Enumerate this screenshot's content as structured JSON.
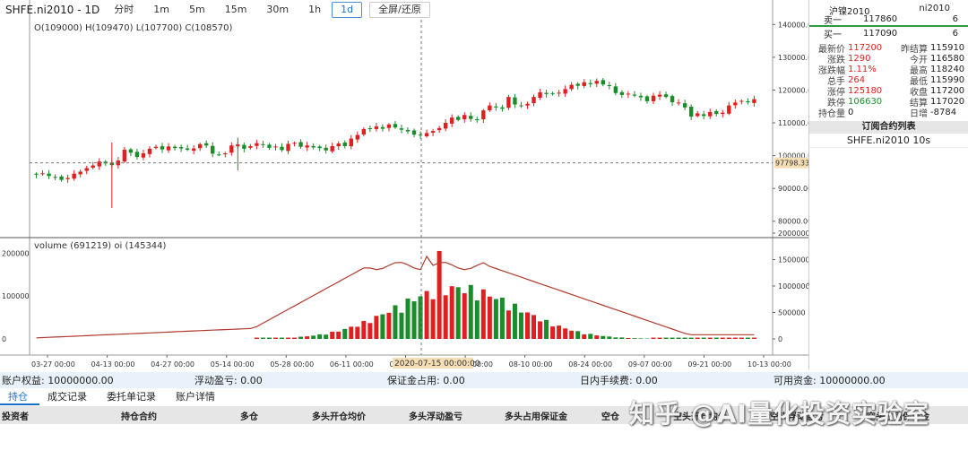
{
  "toolbar": {
    "symbol": "SHFE.ni2010 - 1D",
    "intervals": [
      "分时",
      "1m",
      "5m",
      "15m",
      "30m",
      "1h",
      "1d"
    ],
    "active_interval": "1d",
    "fullscreen_label": "全屏/还原"
  },
  "ohlc_label": "O(109000) H(109470) L(107700) C(108570)",
  "volume_label": "volume (691219) oi (145344)",
  "crosshair_price": "97798.33",
  "crosshair_date": "2020-07-15 00:00:00",
  "price_axis": [
    "140000.00",
    "130000.00",
    "120000.00",
    "110000.00",
    "100000.00",
    "90000.00",
    "80000.00"
  ],
  "volume_axis_left": [
    "200000",
    "100000",
    "0"
  ],
  "volume_axis_right": [
    "2000000",
    "1500000",
    "1000000",
    "500000",
    "0"
  ],
  "date_axis": [
    "03-27 00:00",
    "04-13 00:00",
    "04-27 00:00",
    "05-14 00:00",
    "05-28 00:00",
    "06-11 00:00",
    "06-29 00:00",
    "07-13 00:00",
    "08-10 00:00",
    "08-24 00:00",
    "09-07 00:00",
    "09-21 00:00",
    "10-13 00:00"
  ],
  "side": {
    "name": "沪镍2010",
    "code": "ni2010",
    "ask_label": "卖一",
    "ask_price": "117860",
    "ask_vol": "6",
    "bid_label": "买一",
    "bid_price": "117090",
    "bid_vol": "6",
    "stats": [
      {
        "k1": "最新价",
        "v1": "117200",
        "c1": "red",
        "k2": "昨结算",
        "v2": "115910"
      },
      {
        "k1": "涨跌",
        "v1": "1290",
        "c1": "red",
        "k2": "今开",
        "v2": "116580"
      },
      {
        "k1": "涨跌幅",
        "v1": "1.11%",
        "c1": "red",
        "k2": "最高",
        "v2": "118240"
      },
      {
        "k1": "总手",
        "v1": "264",
        "c1": "red",
        "k2": "最低",
        "v2": "115990"
      },
      {
        "k1": "涨停",
        "v1": "125180",
        "c1": "red",
        "k2": "收盘",
        "v2": "117200"
      },
      {
        "k1": "跌停",
        "v1": "106630",
        "c1": "green",
        "k2": "结算",
        "v2": "117020"
      },
      {
        "k1": "持仓量",
        "v1": "0",
        "c1": "",
        "k2": "日增",
        "v2": "-8784"
      }
    ],
    "sub_title": "订阅合约列表",
    "sub_items": [
      "SHFE.ni2010 10s"
    ]
  },
  "account": {
    "equity": "账户权益: 10000000.00",
    "float_pnl": "浮动盈亏: 0.00",
    "margin": "保证金占用: 0.00",
    "fee": "日内手续费: 0.00",
    "available": "可用资金: 10000000.00"
  },
  "tabs": [
    "持仓",
    "成交记录",
    "委托单记录",
    "账户详情"
  ],
  "active_tab": "持仓",
  "table_headers": [
    "投资者",
    "持仓合约",
    "多仓",
    "多头开仓均价",
    "多头浮动盈亏",
    "多头占用保证金",
    "空仓",
    "空头开仓均价",
    "空头浮动盈亏",
    "空头占用保证金"
  ],
  "watermark": "知乎 @AI量化投资实验室",
  "colors": {
    "up": "#e02020",
    "down": "#1a8d2a",
    "oi_line": "#b03a2e",
    "accent": "#1a6fc8"
  },
  "chart_data": [
    {
      "type": "candlestick",
      "title": "SHFE.ni2010 - 1D",
      "ylim": [
        75000,
        142000
      ],
      "x_range": [
        "03-27",
        "10-16"
      ],
      "closes": [
        94200,
        94600,
        93800,
        93500,
        92600,
        93200,
        94500,
        95100,
        96200,
        97000,
        98200,
        97600,
        97100,
        98500,
        101800,
        100900,
        99600,
        100700,
        102100,
        102700,
        101900,
        102800,
        102300,
        102200,
        101800,
        102200,
        103500,
        103100,
        100600,
        100300,
        100700,
        103100,
        103400,
        102100,
        102900,
        103800,
        103300,
        102400,
        102800,
        101700,
        103600,
        103900,
        102700,
        103100,
        102500,
        102300,
        101600,
        102900,
        103700,
        102900,
        105200,
        106300,
        108100,
        108300,
        108900,
        108200,
        109500,
        108600,
        107900,
        107400,
        106400,
        106200,
        106900,
        107500,
        108400,
        110000,
        111600,
        110900,
        112400,
        111200,
        110800,
        113800,
        115300,
        114700,
        114300,
        117900,
        115600,
        115100,
        115800,
        117900,
        119300,
        118800,
        118900,
        119200,
        120300,
        121600,
        121300,
        122400,
        121800,
        122800,
        121700,
        121300,
        119100,
        118500,
        118900,
        118300,
        117800,
        116600,
        118300,
        118600,
        117900,
        116300,
        116200,
        114700,
        111900,
        112900,
        112100,
        113300,
        112700,
        113100,
        115300,
        116200,
        116700,
        116300,
        117200
      ]
    },
    {
      "type": "bar+line",
      "title": "volume (691219) oi (145344)",
      "series": [
        {
          "name": "volume",
          "ylim": [
            0,
            230000
          ]
        },
        {
          "name": "oi",
          "ylim": [
            0,
            2000000
          ]
        }
      ]
    }
  ]
}
